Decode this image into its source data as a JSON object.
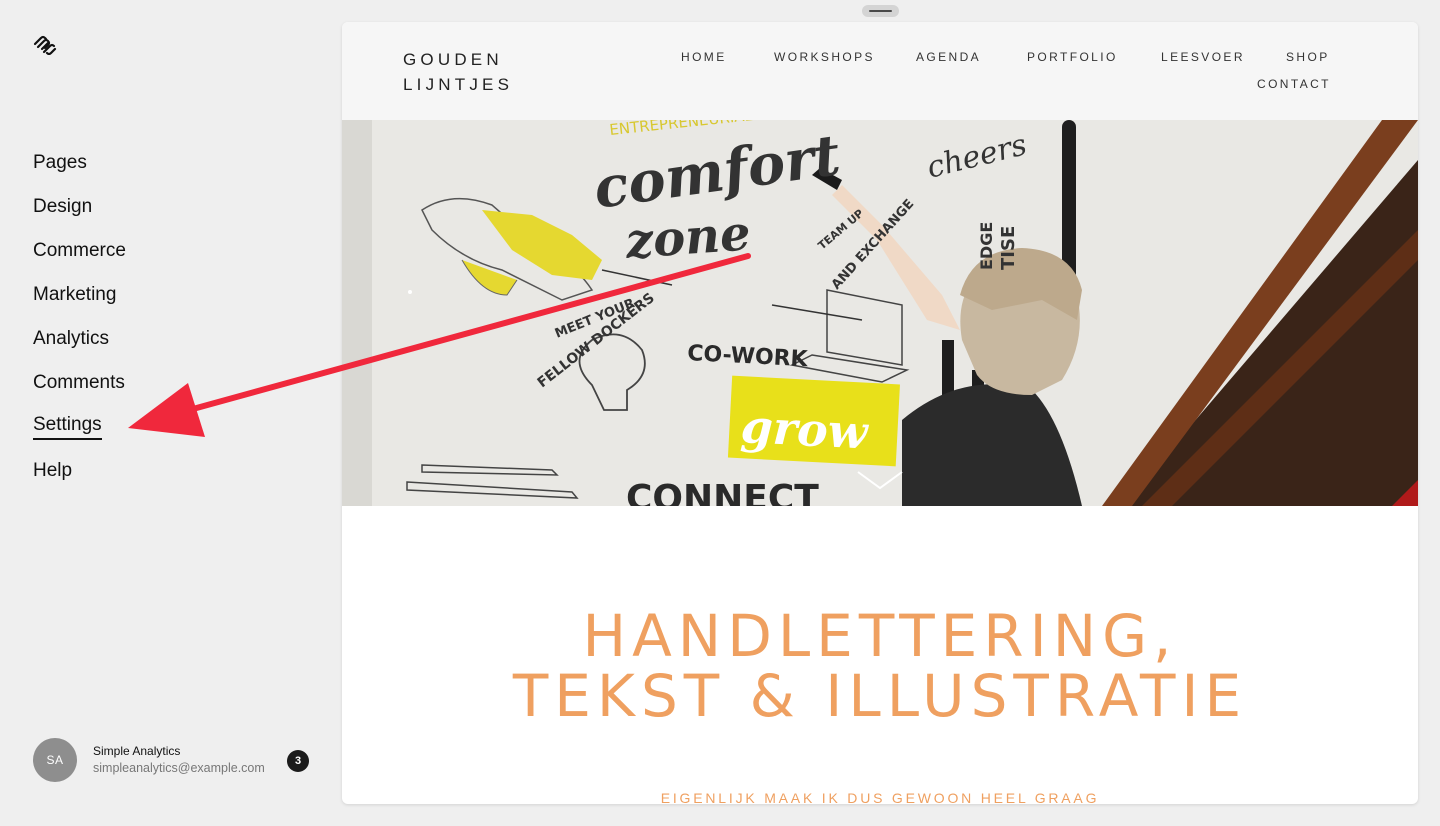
{
  "colors": {
    "annotation_arrow": "#f0283c",
    "headline": "#efa060",
    "avatar_bg": "#8e8e8e"
  },
  "sidebar": {
    "logo_icon": "squarespace-logo-icon",
    "items": [
      {
        "label": "Pages"
      },
      {
        "label": "Design"
      },
      {
        "label": "Commerce"
      },
      {
        "label": "Marketing"
      },
      {
        "label": "Analytics"
      },
      {
        "label": "Comments"
      },
      {
        "label": "Settings",
        "active": true
      },
      {
        "label": "Help"
      }
    ],
    "account": {
      "initials": "SA",
      "name": "Simple Analytics",
      "email": "simpleanalytics@example.com",
      "notifications": "3"
    }
  },
  "site": {
    "brand_line1": "GOUDEN",
    "brand_line2": "LIJNTJES",
    "nav": {
      "home": "HOME",
      "workshops": "WORKSHOPS",
      "agenda": "AGENDA",
      "portfolio": "PORTFOLIO",
      "leesvoer": "LEESVOER",
      "shop": "SHOP",
      "contact": "CONTACT"
    },
    "hero": {
      "wall_text": {
        "entrepreneurial": "ENTREPRENEURIAL",
        "comfort": "comfort",
        "zone": "zone",
        "team_up": "TEAM UP",
        "and_exchange": "AND EXCHANGE",
        "cheers": "cheers",
        "edge": "EDGE",
        "tise": "TISE",
        "meet_your": "MEET YOUR",
        "fellow_dockers": "FELLOW DOCKERS",
        "co_work": "CO-WORK",
        "grow": "grow",
        "connect": "CONNECT"
      },
      "scroll_icon": "chevron-down-icon"
    },
    "headline_line1": "HANDLETTERING,",
    "headline_line2": "TEKST & ILLUSTRATIE",
    "subline": "EIGENLIJK MAAK IK DUS GEWOON HEEL GRAAG"
  }
}
